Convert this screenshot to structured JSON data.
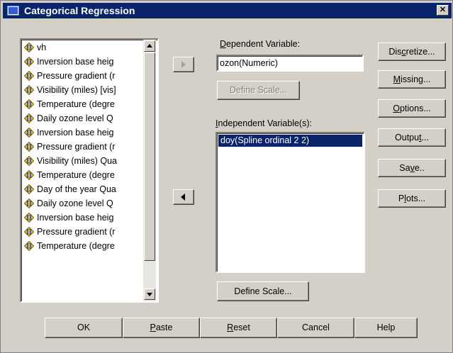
{
  "window": {
    "title": "Categorical Regression",
    "close_glyph": "✕"
  },
  "variable_list": {
    "items": [
      "vh",
      "Inversion base heig",
      "Pressure gradient (r",
      "Visibility (miles) [vis]",
      "Temperature (degre",
      "Daily ozone level Q",
      "Inversion base heig",
      "Pressure gradient (r",
      "Visibility (miles) Qua",
      "Temperature (degre",
      "Day of the year Qua",
      "Daily ozone level Q",
      "Inversion base heig",
      "Pressure gradient (r",
      "Temperature (degre"
    ],
    "icon": "scale-variable-icon"
  },
  "dependent": {
    "label_prefix": "D",
    "label_rest": "ependent Variable:",
    "value": "ozon(Numeric)",
    "define_scale_label": "Define Scale..."
  },
  "independent": {
    "label_prefix": "I",
    "label_rest": "ndependent Variable(s):",
    "items": [
      "doy(Spline ordinal 2 2)"
    ],
    "define_scale_label": "Define Scale..."
  },
  "side_buttons": {
    "discretize": {
      "pre": "Dis",
      "u": "c",
      "post": "retize..."
    },
    "missing": {
      "pre": "",
      "u": "M",
      "post": "issing..."
    },
    "options": {
      "pre": "",
      "u": "O",
      "post": "ptions..."
    },
    "output": {
      "pre": "Outpu",
      "u": "t",
      "post": "..."
    },
    "save": {
      "pre": "Sa",
      "u": "v",
      "post": "e.."
    },
    "plots": {
      "pre": "P",
      "u": "l",
      "post": "ots..."
    }
  },
  "bottom_buttons": {
    "ok": "OK",
    "paste": {
      "u": "P",
      "post": "aste"
    },
    "reset": {
      "u": "R",
      "post": "eset"
    },
    "cancel": "Cancel",
    "help": "Help"
  },
  "colors": {
    "titlebar": "#0a246a",
    "face": "#d4d0c8",
    "selection": "#0a246a"
  }
}
